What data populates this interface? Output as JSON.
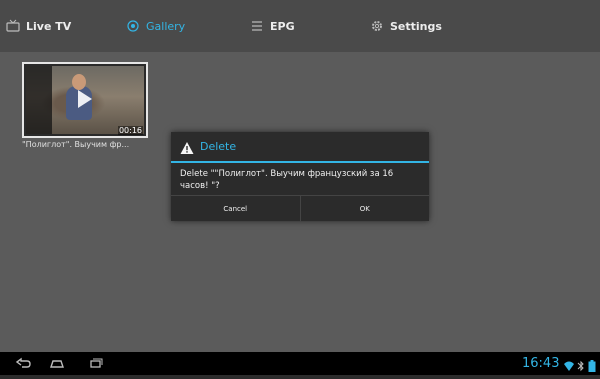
{
  "tabs": [
    {
      "label": "Live TV",
      "icon": "tv-icon"
    },
    {
      "label": "Gallery",
      "icon": "gallery-icon",
      "active": true
    },
    {
      "label": "EPG",
      "icon": "epg-icon"
    },
    {
      "label": "Settings",
      "icon": "gear-icon"
    }
  ],
  "gallery": {
    "items": [
      {
        "duration": "00:16",
        "caption": "\"Полиглот\". Выучим фр..."
      }
    ]
  },
  "dialog": {
    "title": "Delete",
    "message": "Delete \"\"Полиглот\". Выучим французский за 16 часов! \"?",
    "cancel_label": "Cancel",
    "ok_label": "OK"
  },
  "status": {
    "time": "16:43"
  },
  "colors": {
    "accent": "#33b5e5",
    "background": "#5b5b5b",
    "dialog_bg": "#2b2b2b"
  }
}
